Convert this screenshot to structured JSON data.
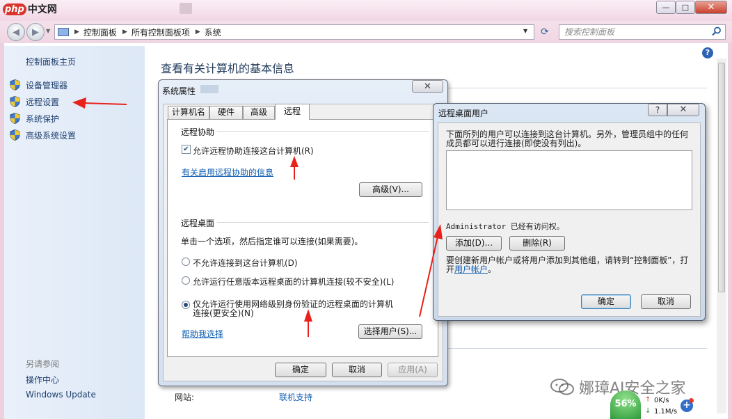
{
  "titlebar": {
    "logo_php": "php",
    "logo_cn": "中文网",
    "minimize": "—",
    "maximize": "□",
    "close": "✕"
  },
  "nav": {
    "breadcrumbs": [
      "控制面板",
      "所有控制面板项",
      "系统"
    ],
    "search_placeholder": "搜索控制面板"
  },
  "sidebar": {
    "home": "控制面板主页",
    "items": [
      {
        "label": "设备管理器",
        "icon": "shield-icon"
      },
      {
        "label": "远程设置",
        "icon": "shield-icon"
      },
      {
        "label": "系统保护",
        "icon": "shield-icon"
      },
      {
        "label": "高级系统设置",
        "icon": "shield-icon"
      }
    ],
    "see_also": "另请参阅",
    "action_center": "操作中心",
    "windows_update": "Windows Update"
  },
  "main": {
    "title": "查看有关计算机的基本信息",
    "website_label": "网站:",
    "website_link": "联机支持"
  },
  "system_properties": {
    "title": "系统属性",
    "close": "✕",
    "tabs": [
      "计算机名",
      "硬件",
      "高级",
      "远程"
    ],
    "active_tab": "远程",
    "remote_assistance": {
      "group_title": "远程协助",
      "checkbox_label": "允许远程协助连接这台计算机(R)",
      "checked": true,
      "info_link": "有关启用远程协助的信息",
      "advanced_button": "高级(V)..."
    },
    "remote_desktop": {
      "group_title": "远程桌面",
      "description": "单击一个选项，然后指定谁可以连接(如果需要)。",
      "option1": "不允许连接到这台计算机(D)",
      "option2": "允许运行任意版本远程桌面的计算机连接(较不安全)(L)",
      "option3": "仅允许运行使用网络级别身份验证的远程桌面的计算机连接(更安全)(N)",
      "selected_option": 3,
      "help_link": "帮助我选择",
      "select_users_button": "选择用户(S)..."
    },
    "ok": "确定",
    "cancel": "取消",
    "apply": "应用(A)"
  },
  "remote_desktop_users": {
    "title": "远程桌面用户",
    "help": "?",
    "close": "✕",
    "description": "下面所列的用户可以连接到这台计算机。另外，管理员组中的任何成员都可以进行连接(即使没有列出)。",
    "access_note": "Administrator 已经有访问权。",
    "add_button": "添加(D)...",
    "remove_button": "删除(R)",
    "create_note": "要创建新用户帐户或将用户添加到其他组，请转到“控制面板”，打开",
    "user_accounts_link": "用户帐户",
    "create_note_end": "。",
    "ok": "确定",
    "cancel": "取消"
  },
  "watermark": {
    "text": "娜璋AI安全之家"
  },
  "net_widget": {
    "cpu": "56%",
    "up": "0K/s",
    "down": "1.1M/s",
    "plus": "+"
  },
  "colors": {
    "annotation_red": "#e8211a",
    "link_blue": "#0a5bb0"
  }
}
